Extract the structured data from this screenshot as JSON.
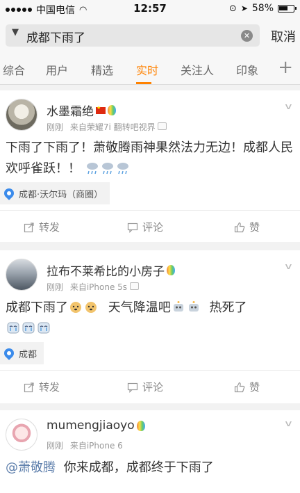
{
  "status_bar": {
    "carrier": "中国电信",
    "time": "12:57",
    "battery": "58%"
  },
  "search": {
    "query": "成都下雨了",
    "cancel_label": "取消"
  },
  "tabs": [
    "综合",
    "用户",
    "精选",
    "实时",
    "关注人",
    "印象"
  ],
  "active_tab": "实时",
  "posts": [
    {
      "username": "水墨霜绝",
      "time": "刚刚",
      "source": "来自荣耀7i 翻转吧视界",
      "text": "下雨了下雨了！萧敬腾雨神果然法力无边！成都人民欢呼雀跃！！",
      "location": "成都·沃尔玛（商圈）",
      "repost_label": "转发",
      "comment_label": "评论",
      "like_label": "赞"
    },
    {
      "username": "拉布不莱希比的小房子",
      "time": "刚刚",
      "source": "来自iPhone 5s",
      "text_a": "成都下雨了",
      "text_b": "天气降温吧",
      "text_c": "热死了",
      "location": "成都",
      "repost_label": "转发",
      "comment_label": "评论",
      "like_label": "赞"
    },
    {
      "username": "mumengjiaoyo",
      "time": "刚刚",
      "source": "来自iPhone 6",
      "mention": "@萧敬腾",
      "text": "你来成都，成都终于下雨了"
    }
  ],
  "colors": {
    "accent": "#ff8200",
    "link": "#5e7fac",
    "location_pin": "#3b8beb"
  }
}
